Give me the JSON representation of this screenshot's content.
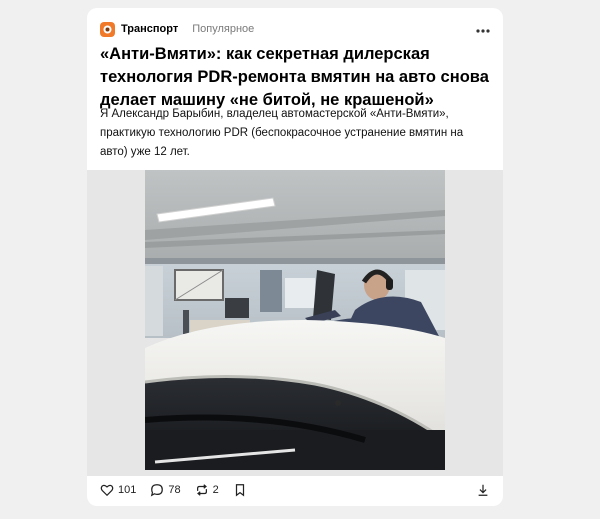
{
  "post": {
    "channel": {
      "name": "Транспорт",
      "tag": "Популярное",
      "logo_icon": "channel-logo-icon",
      "logo_color": "#f07a2a"
    },
    "more_icon": "more-dots-icon",
    "title": "«Анти-Вмяти»: как секретная дилерская технология PDR-ремонта вмятин на авто снова делает машину «не битой, не крашеной»",
    "lead": "Я Александр Барыбин, владелец автомастерской «Анти-Вмяти», практикую технологию PDR (беспокрасочное устранение вмятин на авто) уже 12 лет.",
    "image": {
      "alt": "photo-mechanic-pdr-repair"
    },
    "actions": {
      "likes": "101",
      "comments": "78",
      "reposts": "2",
      "like_icon": "heart-icon",
      "comment_icon": "comment-icon",
      "repost_icon": "repost-icon",
      "bookmark_icon": "bookmark-icon",
      "save_icon": "download-icon"
    }
  }
}
